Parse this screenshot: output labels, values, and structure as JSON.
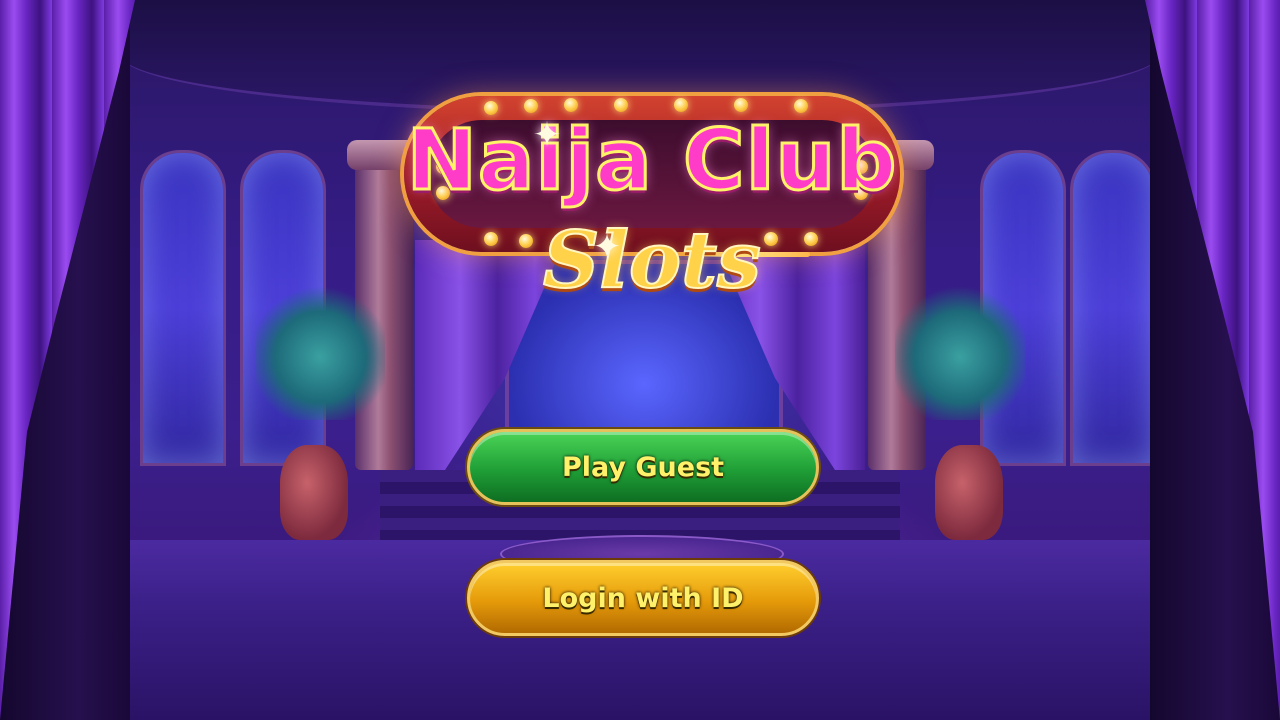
{
  "logo": {
    "title": "Naija Club",
    "subtitle": "Slots"
  },
  "buttons": {
    "play_guest": "Play Guest",
    "login_with_id": "Login with ID"
  },
  "colors": {
    "background_purple": "#351c86",
    "curtain_purple": "#8a4ce8",
    "button_green": "#1f9e36",
    "button_gold": "#e59a0a",
    "button_text": "#fff16a",
    "logo_pink": "#ff3cc8",
    "logo_gold": "#ffd24a"
  }
}
